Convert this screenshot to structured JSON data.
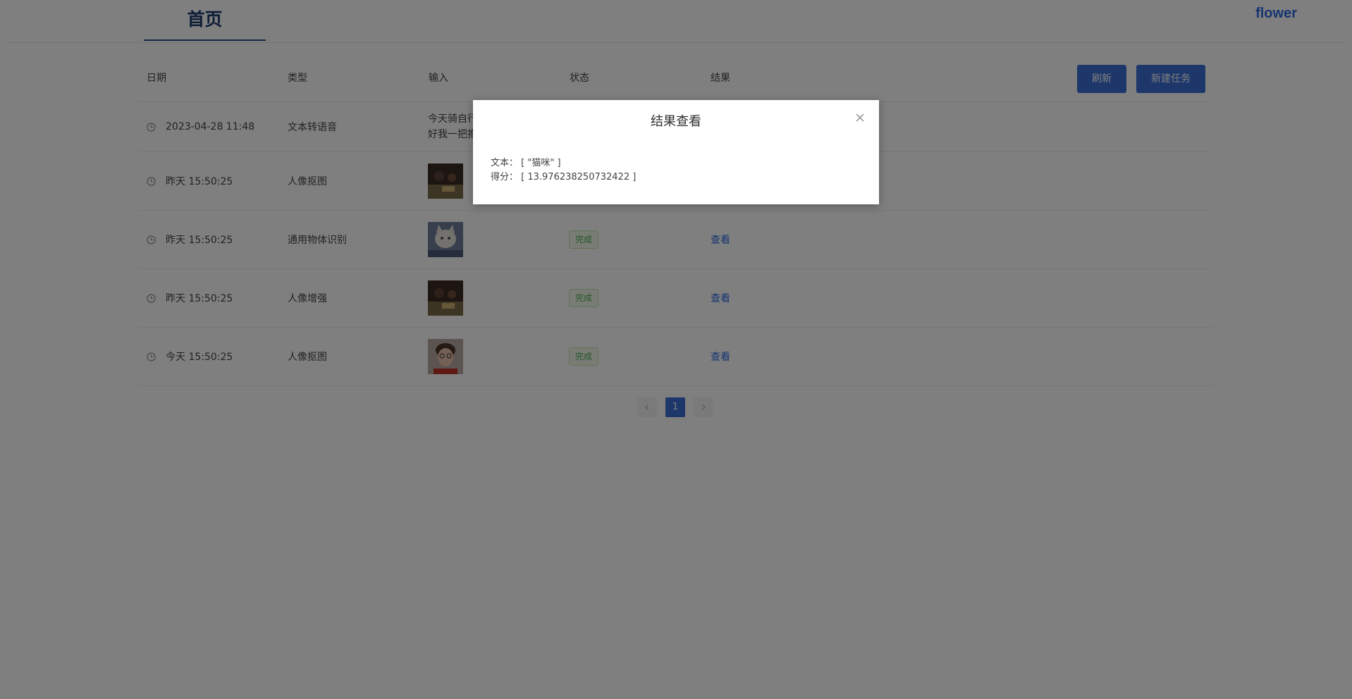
{
  "header": {
    "tab_label": "首页",
    "brand": "flower"
  },
  "table": {
    "headers": [
      "日期",
      "类型",
      "输入",
      "状态",
      "结果"
    ],
    "actions": {
      "refresh": "刷新",
      "new_task": "新建任务"
    },
    "rows": [
      {
        "date": "2023-04-28 11:48",
        "type": "文本转语音",
        "input_text_1": "今天骑自行",
        "input_text_2": "好我一把抱"
      },
      {
        "date": "昨天 15:50:25",
        "type": "人像抠图",
        "input_thumb": "photo-thumb"
      },
      {
        "date": "昨天 15:50:25",
        "type": "通用物体识别",
        "input_thumb": "cat-thumb",
        "status": "完成",
        "result": "查看"
      },
      {
        "date": "昨天 15:50:25",
        "type": "人像增强",
        "input_thumb": "photo-thumb",
        "status": "完成",
        "result": "查看"
      },
      {
        "date": "今天 15:50:25",
        "type": "人像抠图",
        "input_thumb": "portrait-thumb",
        "status": "完成",
        "result": "查看"
      }
    ]
  },
  "pagination": {
    "current": "1",
    "prev_icon": "chevron-left-icon",
    "next_icon": "chevron-right-icon"
  },
  "dialog": {
    "title": "结果查看",
    "text_label": "文本：",
    "text_value": "[ \"猫咪\" ]",
    "score_label": "得分：",
    "score_value": "[ 13.976238250732422 ]"
  },
  "colors": {
    "accent": "#3b6fd6",
    "brand": "#2d6ae3",
    "status_done": "#4caf50",
    "overlay": "rgba(0,0,0,0.5)"
  }
}
